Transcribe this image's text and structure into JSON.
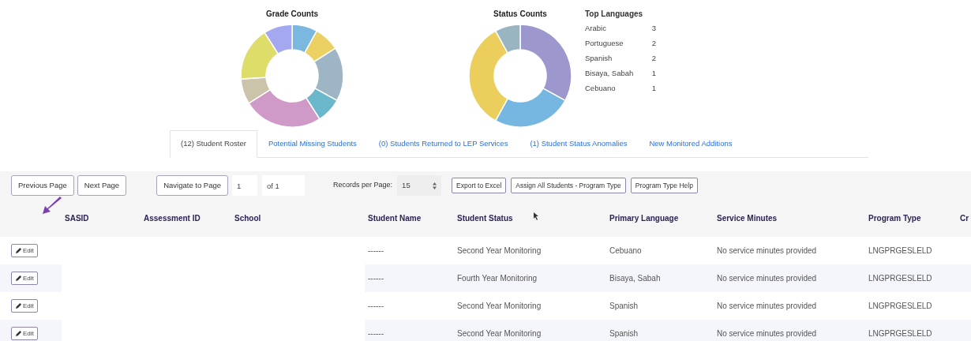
{
  "charts": [
    {
      "title": "Grade Counts"
    },
    {
      "title": "Status Counts"
    }
  ],
  "top_languages": {
    "title": "Top Languages",
    "items": [
      {
        "name": "Arabic",
        "count": "3"
      },
      {
        "name": "Portuguese",
        "count": "2"
      },
      {
        "name": "Spanish",
        "count": "2"
      },
      {
        "name": "Bisaya, Sabah",
        "count": "1"
      },
      {
        "name": "Cebuano",
        "count": "1"
      }
    ]
  },
  "tabs": [
    {
      "label": "(12) Student Roster",
      "selected": true
    },
    {
      "label": "Potential Missing Students",
      "selected": false
    },
    {
      "label": "(0) Students Returned to LEP Services",
      "selected": false
    },
    {
      "label": "(1) Student Status Anomalies",
      "selected": false
    },
    {
      "label": "New Monitored Additions",
      "selected": false
    }
  ],
  "toolbar": {
    "previous": "Previous Page",
    "next": "Next Page",
    "navigate": "Navigate to Page",
    "page": "1",
    "of_pages": "of 1",
    "records_label": "Records per Page:",
    "records_value": "15",
    "export": "Export to Excel",
    "assign": "Assign All Students - Program Type",
    "help": "Program Type Help"
  },
  "table": {
    "columns": [
      "SASID",
      "Assessment ID",
      "School",
      "Student Name",
      "Student Status",
      "Primary Language",
      "Service Minutes",
      "Program Type",
      "Cr"
    ],
    "rows": [
      {
        "action": "Edit",
        "student_name": "------",
        "student_status": "Second Year Monitoring",
        "primary_language": "Cebuano",
        "service_minutes": "No service minutes provided",
        "program_type": "LNGPRGESLELD"
      },
      {
        "action": "Edit",
        "student_name": "------",
        "student_status": "Fourth Year Monitoring",
        "primary_language": "Bisaya, Sabah",
        "service_minutes": "No service minutes provided",
        "program_type": "LNGPRGESLELD"
      },
      {
        "action": "Edit",
        "student_name": "------",
        "student_status": "Second Year Monitoring",
        "primary_language": "Spanish",
        "service_minutes": "No service minutes provided",
        "program_type": "LNGPRGESLELD"
      },
      {
        "action": "Edit",
        "student_name": "------",
        "student_status": "Second Year Monitoring",
        "primary_language": "Spanish",
        "service_minutes": "No service minutes provided",
        "program_type": "LNGPRGESLELD"
      }
    ]
  }
}
